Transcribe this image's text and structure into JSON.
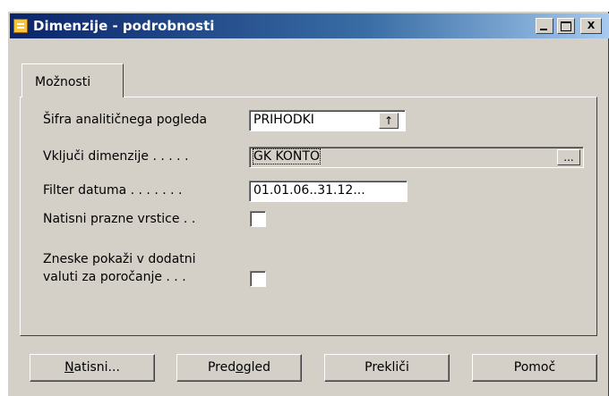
{
  "window": {
    "title": "Dimenzije - podrobnosti",
    "icon": "form-icon",
    "controls": {
      "minimize": "_",
      "maximize": "□",
      "close": "X"
    }
  },
  "tabs": [
    {
      "label": "Možnosti",
      "active": true
    }
  ],
  "form": {
    "analysis_view": {
      "label": "Šifra analitičnega pogleda",
      "value": "PRIHODKI",
      "button": "↑"
    },
    "include_dimensions": {
      "label": "Vključi dimenzije . . . . .",
      "value": "GK KONTO",
      "button": "..."
    },
    "date_filter": {
      "label": "Filter datuma . . . . . . .",
      "value": "01.01.06..31.12..."
    },
    "print_empty_lines": {
      "label": "Natisni prazne vrstice . .",
      "checked": false
    },
    "show_amounts": {
      "label_line1": "Zneske pokaži v dodatni",
      "label_line2": "valuti za poročanje . . .",
      "checked": false
    }
  },
  "buttons": {
    "print_hotkey": "N",
    "print_rest": "atisni...",
    "preview_pre": "Pred",
    "preview_hotkey": "o",
    "preview_rest": "gled",
    "cancel": "Prekliči",
    "help": "Pomoč"
  }
}
